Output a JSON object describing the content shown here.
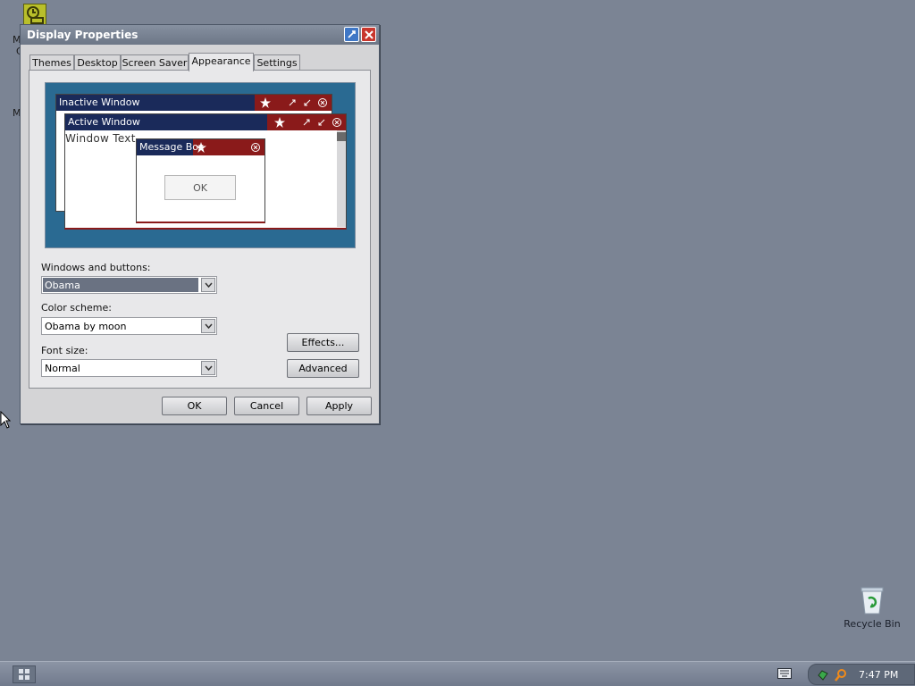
{
  "desktop": {
    "fragments": [
      "M",
      "C",
      "M"
    ],
    "recycle_bin_label": "Recycle Bin"
  },
  "window": {
    "title": "Display Properties",
    "tabs": [
      {
        "label": "Themes"
      },
      {
        "label": "Desktop"
      },
      {
        "label": "Screen Saver"
      },
      {
        "label": "Appearance"
      },
      {
        "label": "Settings"
      }
    ],
    "active_tab": "Appearance"
  },
  "preview": {
    "inactive_title": "Inactive Window",
    "active_title": "Active Window",
    "window_text": "Window Text",
    "message_box_title": "Message Box",
    "message_box_ok": "OK"
  },
  "fields": {
    "windows_buttons_label": "Windows and buttons:",
    "windows_buttons_value": "Obama",
    "color_scheme_label": "Color scheme:",
    "color_scheme_value": "Obama by moon",
    "font_size_label": "Font size:",
    "font_size_value": "Normal"
  },
  "buttons": {
    "effects": "Effects...",
    "advanced": "Advanced",
    "ok": "OK",
    "cancel": "Cancel",
    "apply": "Apply"
  },
  "taskbar": {
    "clock": "7:47 PM"
  },
  "colors": {
    "desktop": "#7b8494",
    "preview_bg": "#2a6a92",
    "title_blue": "#1a2a5a",
    "title_red": "#8a1a1a"
  }
}
